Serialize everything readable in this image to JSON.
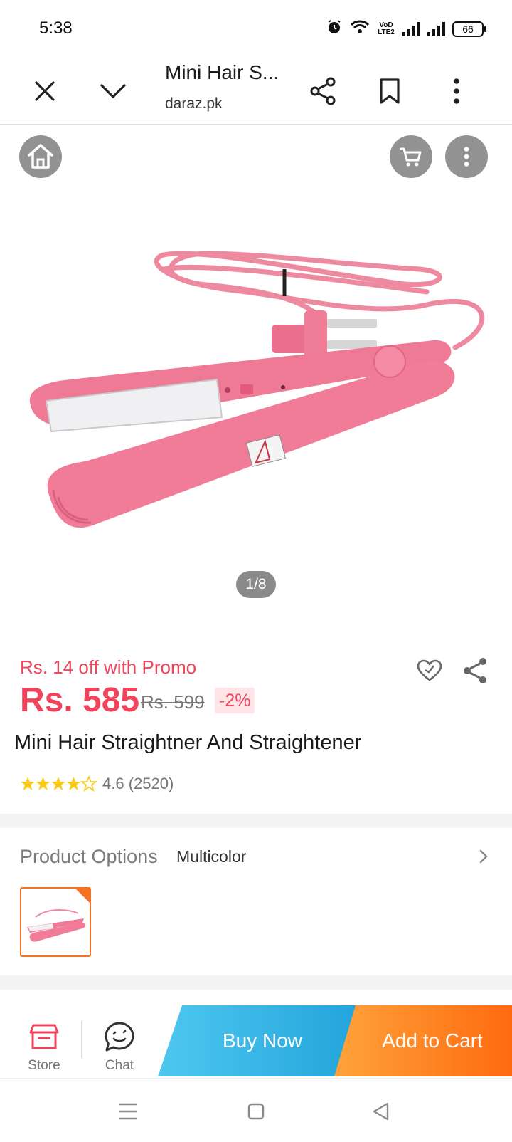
{
  "status_bar": {
    "time": "5:38",
    "network_label": "VoD LTE2",
    "battery": "66"
  },
  "browser": {
    "title": "Mini Hair S...",
    "url": "daraz.pk",
    "icons": [
      "close-icon",
      "chevron-down-icon",
      "share-icon",
      "bookmark-icon",
      "more-vertical-icon"
    ]
  },
  "gallery": {
    "pager": "1/8",
    "icons": [
      "home-icon",
      "cart-icon",
      "more-vertical-icon"
    ]
  },
  "product": {
    "promo": "Rs. 14 off with Promo",
    "price": "Rs. 585",
    "old_price": "Rs. 599",
    "discount": "-2%",
    "title": "Mini Hair Straightner And Straightener",
    "rating_score": 4.6,
    "rating_text": "4.6 (2520)",
    "accent_color": "#f0445c"
  },
  "options": {
    "label": "Product Options",
    "value": "Multicolor"
  },
  "action_bar": {
    "store_label": "Store",
    "chat_label": "Chat",
    "buy_now": "Buy Now",
    "add_to_cart": "Add to Cart",
    "buy_color": "#22a4db",
    "cart_color": "#ff6a10"
  },
  "nav": {
    "icons": [
      "menu-icon",
      "home-square-icon",
      "back-triangle-icon"
    ]
  }
}
